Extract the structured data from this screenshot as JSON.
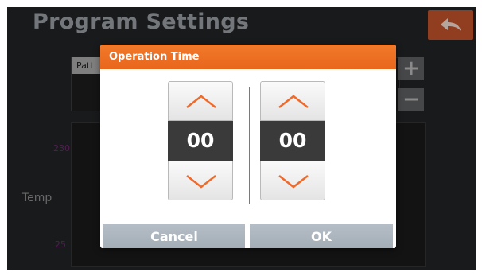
{
  "app": {
    "title": "Program Settings",
    "pattern_tab_label": "Patt",
    "plus_label": "+",
    "minus_label": "−",
    "y_axis": {
      "max_label": "230",
      "min_label": "25",
      "label": "Temp"
    }
  },
  "dialog": {
    "title": "Operation Time",
    "spinners": [
      {
        "value": "00"
      },
      {
        "value": "00"
      }
    ],
    "cancel_label": "Cancel",
    "ok_label": "OK"
  },
  "colors": {
    "accent_orange": "#e8661c",
    "back_button": "#c0532a",
    "dialog_button": "#a9b3bc",
    "spinner_value_bg": "#3a3a3a",
    "arrow": "#ef6a2a"
  },
  "icons": {
    "back": "back-arrow-icon",
    "up": "chevron-up-icon",
    "down": "chevron-down-icon"
  }
}
